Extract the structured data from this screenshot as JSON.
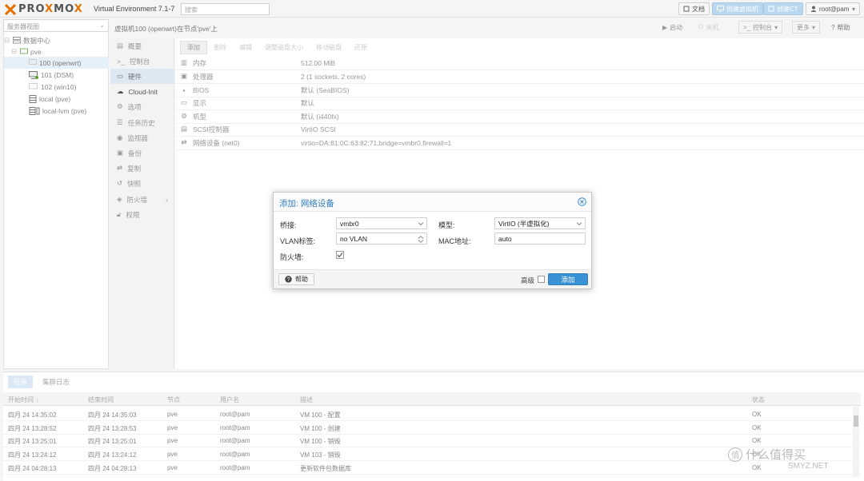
{
  "header": {
    "brand": "PRO",
    "brand_x1": "X",
    "brand_mid": "MO",
    "brand_x2": "X",
    "version": "Virtual Environment 7.1-7",
    "search_placeholder": "搜索",
    "docs": "文档",
    "create_vm": "创建虚拟机",
    "create_ct": "创建CT",
    "user": "root@pam"
  },
  "tree": {
    "view": "服务器视图",
    "items": [
      {
        "label": "数据中心",
        "icon": "server-rack-icon"
      },
      {
        "label": "pve",
        "icon": "node-icon"
      },
      {
        "label": "100 (openwrt)",
        "icon": "monitor-icon"
      },
      {
        "label": "101 (DSM)",
        "icon": "monitor-icon"
      },
      {
        "label": "102 (win10)",
        "icon": "monitor-icon"
      },
      {
        "label": "local (pve)",
        "icon": "storage-icon"
      },
      {
        "label": "local-lvm (pve)",
        "icon": "storage-icon"
      }
    ]
  },
  "breadcrumb": "虚拟机100 (openwrt)在节点'pve'上",
  "actions": {
    "start": "启动",
    "shutdown": "关机",
    "console": "控制台",
    "more": "更多",
    "help": "帮助"
  },
  "nav": [
    {
      "label": "概要",
      "icon": "summary-icon"
    },
    {
      "label": "控制台",
      "icon": "terminal-icon"
    },
    {
      "label": "硬件",
      "icon": "hardware-icon"
    },
    {
      "label": "Cloud-Init",
      "icon": "cloud-icon"
    },
    {
      "label": "选项",
      "icon": "gear-icon"
    },
    {
      "label": "任务历史",
      "icon": "list-icon"
    },
    {
      "label": "监视器",
      "icon": "eye-icon"
    },
    {
      "label": "备份",
      "icon": "floppy-icon"
    },
    {
      "label": "复制",
      "icon": "retweet-icon"
    },
    {
      "label": "快照",
      "icon": "history-icon"
    },
    {
      "label": "防火墙",
      "icon": "shield-icon"
    },
    {
      "label": "权限",
      "icon": "unlock-icon"
    }
  ],
  "hw_toolbar": [
    "添加",
    "删除",
    "编辑",
    "调整磁盘大小",
    "移动磁盘",
    "还原"
  ],
  "hardware": [
    {
      "key": "内存",
      "value": "512.00 MiB",
      "icon": "memory-icon"
    },
    {
      "key": "处理器",
      "value": "2 (1 sockets, 2 cores)",
      "icon": "cpu-icon"
    },
    {
      "key": "BIOS",
      "value": "默认 (SeaBIOS)",
      "icon": "chip-icon"
    },
    {
      "key": "显示",
      "value": "默认",
      "icon": "display-icon"
    },
    {
      "key": "机型",
      "value": "默认 (i440fx)",
      "icon": "cogs-icon"
    },
    {
      "key": "SCSI控制器",
      "value": "VirtIO SCSI",
      "icon": "database-icon"
    },
    {
      "key": "网络设备 (net0)",
      "value": "virtio=DA:81:0C:63:82:71,bridge=vmbr0,firewall=1",
      "icon": "exchange-icon"
    }
  ],
  "dialog": {
    "title": "添加: 网络设备",
    "bridge_label": "桥接:",
    "bridge_value": "vmbr0",
    "vlan_label": "VLAN标签:",
    "vlan_value": "no VLAN",
    "firewall_label": "防火墙:",
    "model_label": "模型:",
    "model_value": "VirtIO (半虚拟化)",
    "mac_label": "MAC地址:",
    "mac_value": "auto",
    "help": "帮助",
    "advanced": "高级",
    "add": "添加"
  },
  "tasks": {
    "tabs": [
      "任务",
      "集群日志"
    ],
    "columns": [
      "开始时间 ↓",
      "结束时间",
      "节点",
      "用户名",
      "描述",
      "状态"
    ],
    "rows": [
      [
        "四月 24 14:35:02",
        "四月 24 14:35:03",
        "pve",
        "root@pam",
        "VM 100 - 配置",
        "OK"
      ],
      [
        "四月 24 13:28:52",
        "四月 24 13:28:53",
        "pve",
        "root@pam",
        "VM 100 - 创建",
        "OK"
      ],
      [
        "四月 24 13:25:01",
        "四月 24 13:25:01",
        "pve",
        "root@pam",
        "VM 100 - 销毁",
        "OK"
      ],
      [
        "四月 24 13:24:12",
        "四月 24 13:24:12",
        "pve",
        "root@pam",
        "VM 103 - 销毁",
        "OK"
      ],
      [
        "四月 24 04:28:13",
        "四月 24 04:28:13",
        "pve",
        "root@pam",
        "更新软件包数据库",
        "OK"
      ]
    ]
  },
  "watermark": {
    "glyph": "值",
    "text": "什么值得买",
    "site": "SMYZ.NET"
  }
}
